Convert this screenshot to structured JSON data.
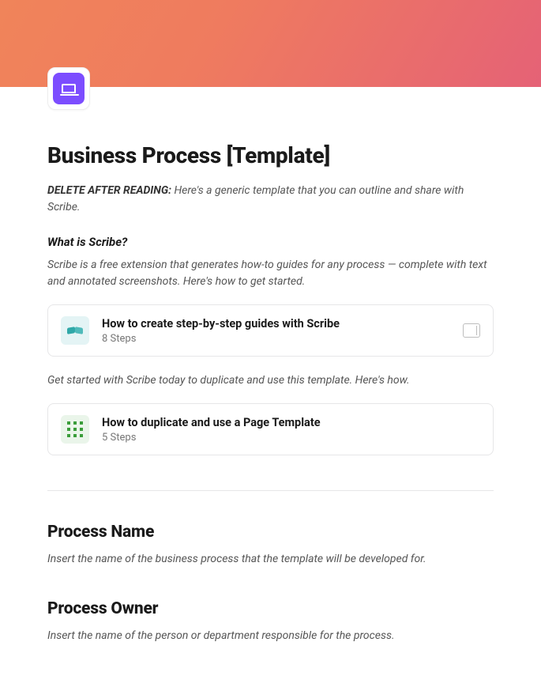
{
  "title": "Business Process [Template]",
  "delete_note_label": "DELETE AFTER READING:",
  "delete_note_text": " Here's a generic template that you can outline and share with Scribe.",
  "intro": {
    "heading": "What is Scribe?",
    "text": "Scribe is a free extension that generates how-to guides for any process — complete with text and annotated screenshots. Here's how to get started."
  },
  "cards": [
    {
      "title": "How to create step-by-step guides with Scribe",
      "meta": "8 Steps"
    },
    {
      "title": "How to duplicate and use a Page Template",
      "meta": "5 Steps"
    }
  ],
  "mid_text": "Get started with Scribe today to duplicate and use this template. Here's how.",
  "sections": [
    {
      "heading": "Process Name",
      "text": "Insert the name of the business process that the template will be developed for."
    },
    {
      "heading": "Process Owner",
      "text": "Insert the name of the person or department responsible for the process."
    }
  ]
}
